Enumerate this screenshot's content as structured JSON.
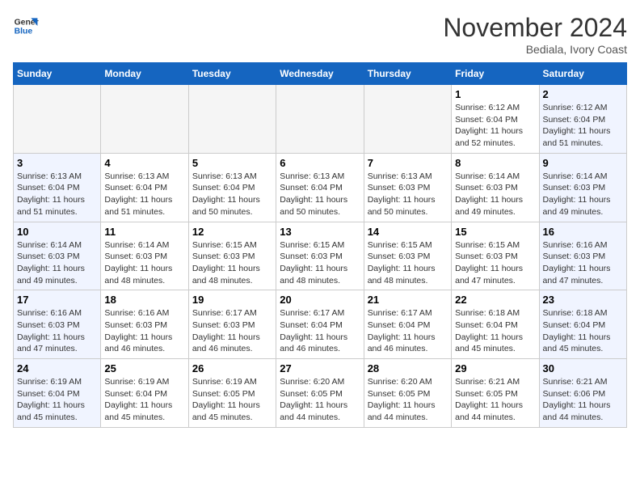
{
  "header": {
    "logo_line1": "General",
    "logo_line2": "Blue",
    "month_title": "November 2024",
    "subtitle": "Bediala, Ivory Coast"
  },
  "weekdays": [
    "Sunday",
    "Monday",
    "Tuesday",
    "Wednesday",
    "Thursday",
    "Friday",
    "Saturday"
  ],
  "weeks": [
    [
      {
        "day": "",
        "info": ""
      },
      {
        "day": "",
        "info": ""
      },
      {
        "day": "",
        "info": ""
      },
      {
        "day": "",
        "info": ""
      },
      {
        "day": "",
        "info": ""
      },
      {
        "day": "1",
        "info": "Sunrise: 6:12 AM\nSunset: 6:04 PM\nDaylight: 11 hours and 52 minutes."
      },
      {
        "day": "2",
        "info": "Sunrise: 6:12 AM\nSunset: 6:04 PM\nDaylight: 11 hours and 51 minutes."
      }
    ],
    [
      {
        "day": "3",
        "info": "Sunrise: 6:13 AM\nSunset: 6:04 PM\nDaylight: 11 hours and 51 minutes."
      },
      {
        "day": "4",
        "info": "Sunrise: 6:13 AM\nSunset: 6:04 PM\nDaylight: 11 hours and 51 minutes."
      },
      {
        "day": "5",
        "info": "Sunrise: 6:13 AM\nSunset: 6:04 PM\nDaylight: 11 hours and 50 minutes."
      },
      {
        "day": "6",
        "info": "Sunrise: 6:13 AM\nSunset: 6:04 PM\nDaylight: 11 hours and 50 minutes."
      },
      {
        "day": "7",
        "info": "Sunrise: 6:13 AM\nSunset: 6:03 PM\nDaylight: 11 hours and 50 minutes."
      },
      {
        "day": "8",
        "info": "Sunrise: 6:14 AM\nSunset: 6:03 PM\nDaylight: 11 hours and 49 minutes."
      },
      {
        "day": "9",
        "info": "Sunrise: 6:14 AM\nSunset: 6:03 PM\nDaylight: 11 hours and 49 minutes."
      }
    ],
    [
      {
        "day": "10",
        "info": "Sunrise: 6:14 AM\nSunset: 6:03 PM\nDaylight: 11 hours and 49 minutes."
      },
      {
        "day": "11",
        "info": "Sunrise: 6:14 AM\nSunset: 6:03 PM\nDaylight: 11 hours and 48 minutes."
      },
      {
        "day": "12",
        "info": "Sunrise: 6:15 AM\nSunset: 6:03 PM\nDaylight: 11 hours and 48 minutes."
      },
      {
        "day": "13",
        "info": "Sunrise: 6:15 AM\nSunset: 6:03 PM\nDaylight: 11 hours and 48 minutes."
      },
      {
        "day": "14",
        "info": "Sunrise: 6:15 AM\nSunset: 6:03 PM\nDaylight: 11 hours and 48 minutes."
      },
      {
        "day": "15",
        "info": "Sunrise: 6:15 AM\nSunset: 6:03 PM\nDaylight: 11 hours and 47 minutes."
      },
      {
        "day": "16",
        "info": "Sunrise: 6:16 AM\nSunset: 6:03 PM\nDaylight: 11 hours and 47 minutes."
      }
    ],
    [
      {
        "day": "17",
        "info": "Sunrise: 6:16 AM\nSunset: 6:03 PM\nDaylight: 11 hours and 47 minutes."
      },
      {
        "day": "18",
        "info": "Sunrise: 6:16 AM\nSunset: 6:03 PM\nDaylight: 11 hours and 46 minutes."
      },
      {
        "day": "19",
        "info": "Sunrise: 6:17 AM\nSunset: 6:03 PM\nDaylight: 11 hours and 46 minutes."
      },
      {
        "day": "20",
        "info": "Sunrise: 6:17 AM\nSunset: 6:04 PM\nDaylight: 11 hours and 46 minutes."
      },
      {
        "day": "21",
        "info": "Sunrise: 6:17 AM\nSunset: 6:04 PM\nDaylight: 11 hours and 46 minutes."
      },
      {
        "day": "22",
        "info": "Sunrise: 6:18 AM\nSunset: 6:04 PM\nDaylight: 11 hours and 45 minutes."
      },
      {
        "day": "23",
        "info": "Sunrise: 6:18 AM\nSunset: 6:04 PM\nDaylight: 11 hours and 45 minutes."
      }
    ],
    [
      {
        "day": "24",
        "info": "Sunrise: 6:19 AM\nSunset: 6:04 PM\nDaylight: 11 hours and 45 minutes."
      },
      {
        "day": "25",
        "info": "Sunrise: 6:19 AM\nSunset: 6:04 PM\nDaylight: 11 hours and 45 minutes."
      },
      {
        "day": "26",
        "info": "Sunrise: 6:19 AM\nSunset: 6:05 PM\nDaylight: 11 hours and 45 minutes."
      },
      {
        "day": "27",
        "info": "Sunrise: 6:20 AM\nSunset: 6:05 PM\nDaylight: 11 hours and 44 minutes."
      },
      {
        "day": "28",
        "info": "Sunrise: 6:20 AM\nSunset: 6:05 PM\nDaylight: 11 hours and 44 minutes."
      },
      {
        "day": "29",
        "info": "Sunrise: 6:21 AM\nSunset: 6:05 PM\nDaylight: 11 hours and 44 minutes."
      },
      {
        "day": "30",
        "info": "Sunrise: 6:21 AM\nSunset: 6:06 PM\nDaylight: 11 hours and 44 minutes."
      }
    ]
  ]
}
